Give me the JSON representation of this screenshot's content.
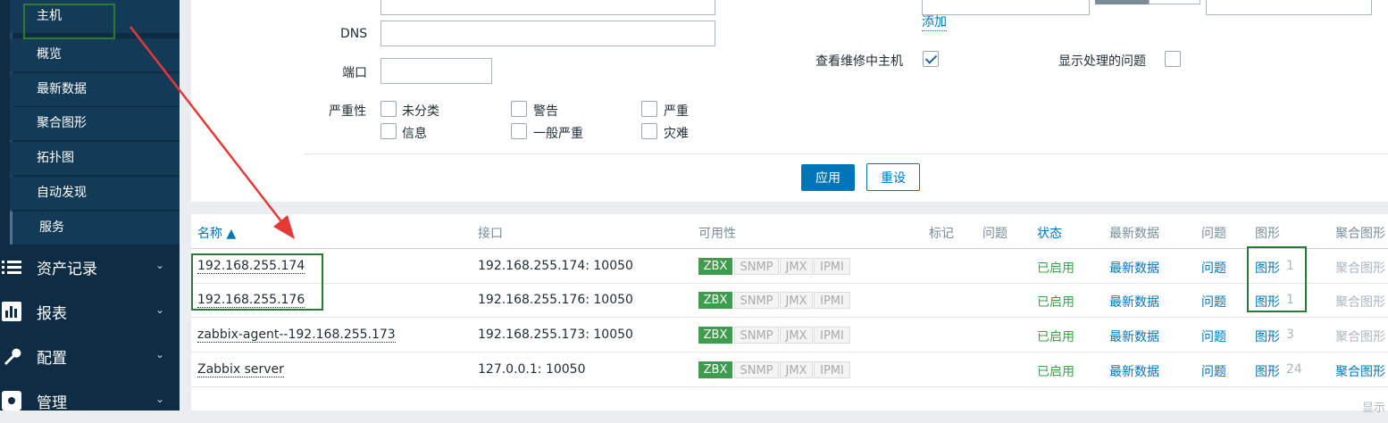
{
  "sidebar": {
    "sub_items": [
      "主机",
      "概览",
      "最新数据",
      "聚合图形",
      "拓扑图",
      "自动发现",
      "服务"
    ],
    "menus": [
      {
        "label": "资产记录",
        "icon": "list-icon"
      },
      {
        "label": "报表",
        "icon": "bar-chart-icon"
      },
      {
        "label": "配置",
        "icon": "wrench-icon"
      },
      {
        "label": "管理",
        "icon": "gear-icon"
      }
    ]
  },
  "filter": {
    "dns_label": "DNS",
    "port_label": "端口",
    "severity_label": "严重性",
    "add_link": "添加",
    "maintenance_label": "查看维修中主机",
    "show_suppressed_label": "显示处理的问题",
    "severities": [
      "未分类",
      "警告",
      "严重",
      "信息",
      "一般严重",
      "灾难"
    ],
    "apply_label": "应用",
    "reset_label": "重设"
  },
  "table": {
    "headers": {
      "name": "名称 ▲",
      "interface": "接口",
      "availability": "可用性",
      "tags": "标记",
      "problems": "问题",
      "status": "状态",
      "latest_data": "最新数据",
      "problems2": "问题",
      "graphs": "图形",
      "screens": "聚合图形"
    },
    "rows": [
      {
        "name": "192.168.255.174",
        "interface": "192.168.255.174: 10050",
        "status": "已启用",
        "latest": "最新数据",
        "problems": "问题",
        "graphs_label": "图形",
        "graphs_count": "1",
        "screens": "聚合图形"
      },
      {
        "name": "192.168.255.176",
        "interface": "192.168.255.176: 10050",
        "status": "已启用",
        "latest": "最新数据",
        "problems": "问题",
        "graphs_label": "图形",
        "graphs_count": "1",
        "screens": "聚合图形"
      },
      {
        "name": "zabbix-agent--192.168.255.173",
        "interface": "192.168.255.173: 10050",
        "status": "已启用",
        "latest": "最新数据",
        "problems": "问题",
        "graphs_label": "图形",
        "graphs_count": "3",
        "screens": "聚合图形"
      },
      {
        "name": "Zabbix server",
        "interface": "127.0.0.1: 10050",
        "status": "已启用",
        "latest": "最新数据",
        "problems": "问题",
        "graphs_label": "图形",
        "graphs_count": "24",
        "screens": "聚合图形"
      }
    ],
    "badges": [
      "ZBX",
      "SNMP",
      "JMX",
      "IPMI"
    ],
    "footer_text": "显示"
  },
  "colors": {
    "sidebar_bg": "#0e2d45",
    "sidebar_item_bg": "#133a56",
    "accent_blue": "#0275b8",
    "status_green": "#3c9f4b",
    "annotation_red": "#e53935",
    "annotation_green": "#2d7a36"
  }
}
